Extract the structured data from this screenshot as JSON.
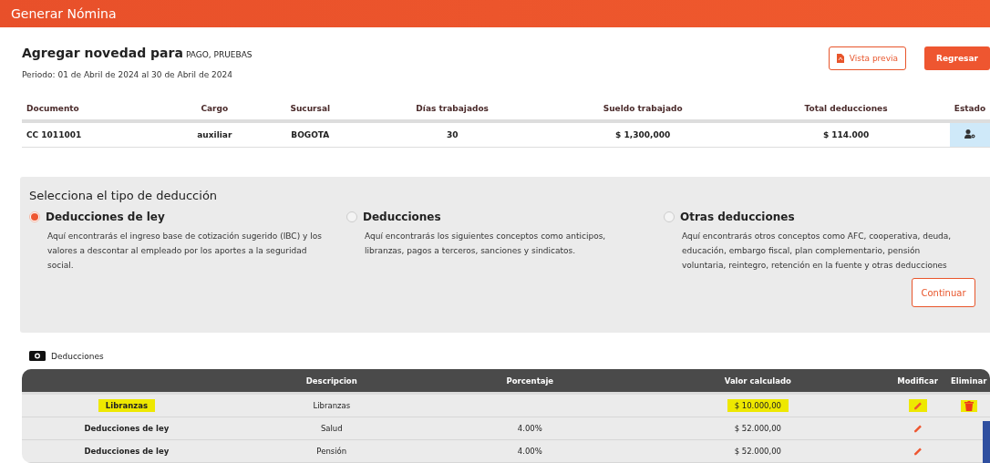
{
  "header": {
    "title": "Generar Nómina"
  },
  "heading": {
    "label": "Agregar novedad para",
    "name": "PAGO, PRUEBAS"
  },
  "period": "Periodo: 01 de Abril de 2024 al 30 de Abril de 2024",
  "buttons": [
    {
      "label": "Vista previa",
      "kind": "outline"
    },
    {
      "label": "Regresar",
      "kind": "filled"
    }
  ],
  "employee_table": {
    "columns": [
      "Documento",
      "Cargo",
      "Sucursal",
      "Días trabajados",
      "Sueldo trabajado",
      "Total deducciones",
      "Estado"
    ],
    "rows": [
      {
        "cells": [
          "CC 1011001",
          "auxiliar",
          "BOGOTA",
          "30",
          "$ 1,300,000",
          "$ 114.000"
        ]
      }
    ]
  },
  "deduction_type": {
    "title": "Selecciona el tipo de deducción",
    "options": [
      {
        "label": "Deducciones de ley",
        "selected": true,
        "description": "Aquí encontrarás el ingreso base de cotización sugerido (IBC) y los valores a descontar al empleado por los aportes a la seguridad social."
      },
      {
        "label": "Deducciones",
        "selected": false,
        "description": "Aquí encontrarás los siguientes conceptos como anticipos, libranzas, pagos a terceros, sanciones y sindicatos."
      },
      {
        "label": "Otras deducciones",
        "selected": false,
        "description": "Aquí encontrarás otros conceptos como AFC, cooperativa, deuda, educación, embargo fiscal, plan complementario, pensión voluntaria, reintegro, retención en la fuente y otras deducciones"
      }
    ],
    "button": "Continuar"
  },
  "deductions": {
    "title": "Deducciones",
    "columns": [
      "Descripcion",
      "Porcentaje",
      "Valor calculado",
      "Modificar",
      "Eliminar"
    ],
    "rows": [
      {
        "type": "Libranzas",
        "description": "Libranzas",
        "percentage": "",
        "value": "$ 10.000,00",
        "highlighted": true,
        "deletable": true
      },
      {
        "type": "Deducciones de ley",
        "description": "Salud",
        "percentage": "4.00%",
        "value": "$ 52.000,00",
        "highlighted": false,
        "deletable": false
      },
      {
        "type": "Deducciones de ley",
        "description": "Pensión",
        "percentage": "4.00%",
        "value": "$ 52.000,00",
        "highlighted": false,
        "deletable": false
      }
    ]
  }
}
